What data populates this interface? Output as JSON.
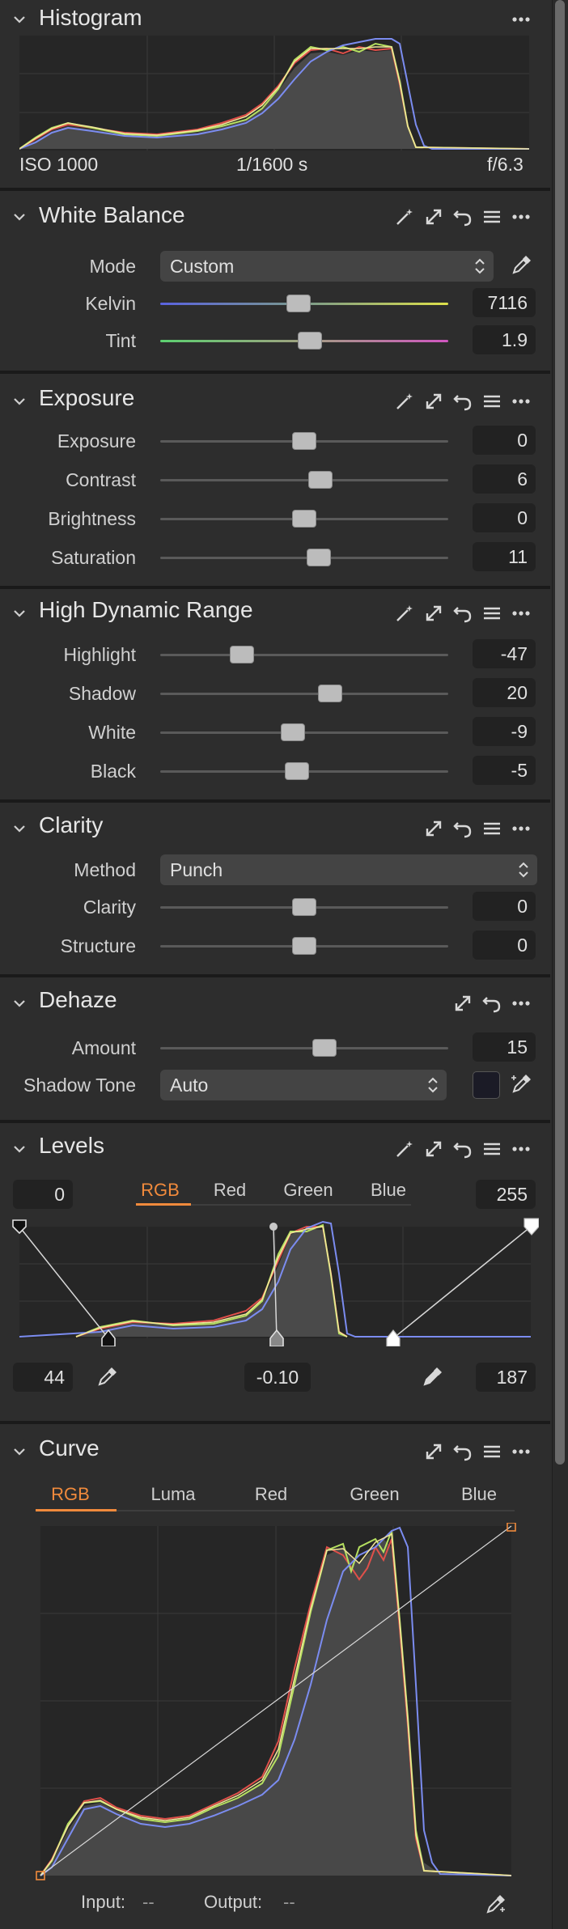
{
  "colors": {
    "accent": "#f08a3c",
    "panel_bg": "#2d2d2d",
    "field_bg": "#222222"
  },
  "histogram": {
    "title": "Histogram",
    "iso": "ISO 1000",
    "shutter": "1/1600 s",
    "aperture": "f/6.3"
  },
  "white_balance": {
    "title": "White Balance",
    "mode_label": "Mode",
    "mode_value": "Custom",
    "kelvin_label": "Kelvin",
    "kelvin_value": "7116",
    "kelvin_level": 0.48,
    "tint_label": "Tint",
    "tint_value": "1.9",
    "tint_level": 0.52
  },
  "exposure": {
    "title": "Exposure",
    "rows": [
      {
        "label": "Exposure",
        "value": "0",
        "level": 0.5
      },
      {
        "label": "Contrast",
        "value": "6",
        "level": 0.555
      },
      {
        "label": "Brightness",
        "value": "0",
        "level": 0.5
      },
      {
        "label": "Saturation",
        "value": "11",
        "level": 0.55
      }
    ]
  },
  "hdr": {
    "title": "High Dynamic Range",
    "rows": [
      {
        "label": "Highlight",
        "value": "-47",
        "level": 0.285
      },
      {
        "label": "Shadow",
        "value": "20",
        "level": 0.59
      },
      {
        "label": "White",
        "value": "-9",
        "level": 0.46
      },
      {
        "label": "Black",
        "value": "-5",
        "level": 0.475
      }
    ]
  },
  "clarity": {
    "title": "Clarity",
    "method_label": "Method",
    "method_value": "Punch",
    "rows": [
      {
        "label": "Clarity",
        "value": "0",
        "level": 0.5
      },
      {
        "label": "Structure",
        "value": "0",
        "level": 0.5
      }
    ]
  },
  "dehaze": {
    "title": "Dehaze",
    "amount_label": "Amount",
    "amount_value": "15",
    "amount_level": 0.57,
    "shadow_tone_label": "Shadow Tone",
    "shadow_tone_value": "Auto"
  },
  "levels": {
    "title": "Levels",
    "input_low": "0",
    "input_high": "255",
    "tabs": [
      "RGB",
      "Red",
      "Green",
      "Blue"
    ],
    "active_tab": "RGB",
    "black_point": "44",
    "midtone": "-0.10",
    "white_point": "187"
  },
  "curve": {
    "title": "Curve",
    "tabs": [
      "RGB",
      "Luma",
      "Red",
      "Green",
      "Blue"
    ],
    "active_tab": "RGB",
    "input_label": "Input:",
    "input_value": "--",
    "output_label": "Output:",
    "output_value": "--"
  }
}
